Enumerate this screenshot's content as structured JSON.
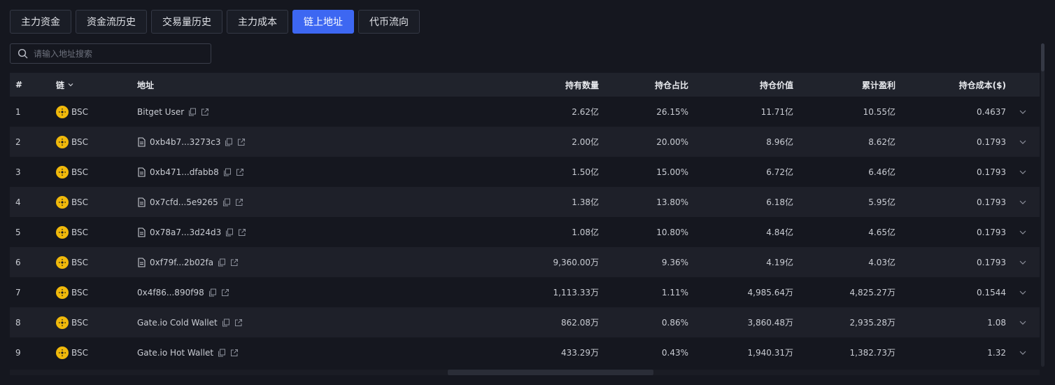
{
  "tabs": [
    {
      "label": "主力资金",
      "active": false
    },
    {
      "label": "资金流历史",
      "active": false
    },
    {
      "label": "交易量历史",
      "active": false
    },
    {
      "label": "主力成本",
      "active": false
    },
    {
      "label": "链上地址",
      "active": true
    },
    {
      "label": "代币流向",
      "active": false
    }
  ],
  "search": {
    "placeholder": "请输入地址搜索",
    "value": ""
  },
  "table": {
    "headers": {
      "index": "#",
      "chain": "链",
      "address": "地址",
      "quantity": "持有数量",
      "share": "持仓占比",
      "value": "持仓价值",
      "pnl": "累计盈利",
      "cost": "持仓成本($)"
    },
    "rows": [
      {
        "index": "1",
        "chain": "BSC",
        "address": "Bitget User",
        "contract": false,
        "quantity": "2.62亿",
        "share": "26.15%",
        "value": "11.71亿",
        "pnl": "10.55亿",
        "cost": "0.4637"
      },
      {
        "index": "2",
        "chain": "BSC",
        "address": "0xb4b7...3273c3",
        "contract": true,
        "quantity": "2.00亿",
        "share": "20.00%",
        "value": "8.96亿",
        "pnl": "8.62亿",
        "cost": "0.1793"
      },
      {
        "index": "3",
        "chain": "BSC",
        "address": "0xb471...dfabb8",
        "contract": true,
        "quantity": "1.50亿",
        "share": "15.00%",
        "value": "6.72亿",
        "pnl": "6.46亿",
        "cost": "0.1793"
      },
      {
        "index": "4",
        "chain": "BSC",
        "address": "0x7cfd...5e9265",
        "contract": true,
        "quantity": "1.38亿",
        "share": "13.80%",
        "value": "6.18亿",
        "pnl": "5.95亿",
        "cost": "0.1793"
      },
      {
        "index": "5",
        "chain": "BSC",
        "address": "0x78a7...3d24d3",
        "contract": true,
        "quantity": "1.08亿",
        "share": "10.80%",
        "value": "4.84亿",
        "pnl": "4.65亿",
        "cost": "0.1793"
      },
      {
        "index": "6",
        "chain": "BSC",
        "address": "0xf79f...2b02fa",
        "contract": true,
        "quantity": "9,360.00万",
        "share": "9.36%",
        "value": "4.19亿",
        "pnl": "4.03亿",
        "cost": "0.1793"
      },
      {
        "index": "7",
        "chain": "BSC",
        "address": "0x4f86...890f98",
        "contract": false,
        "quantity": "1,113.33万",
        "share": "1.11%",
        "value": "4,985.64万",
        "pnl": "4,825.27万",
        "cost": "0.1544"
      },
      {
        "index": "8",
        "chain": "BSC",
        "address": "Gate.io Cold Wallet",
        "contract": false,
        "quantity": "862.08万",
        "share": "0.86%",
        "value": "3,860.48万",
        "pnl": "2,935.28万",
        "cost": "1.08"
      },
      {
        "index": "9",
        "chain": "BSC",
        "address": "Gate.io Hot Wallet",
        "contract": false,
        "quantity": "433.29万",
        "share": "0.43%",
        "value": "1,940.31万",
        "pnl": "1,382.73万",
        "cost": "1.32"
      }
    ]
  },
  "colors": {
    "accent": "#3d67f2",
    "bnb": "#f0b90b",
    "background": "#15171f"
  }
}
